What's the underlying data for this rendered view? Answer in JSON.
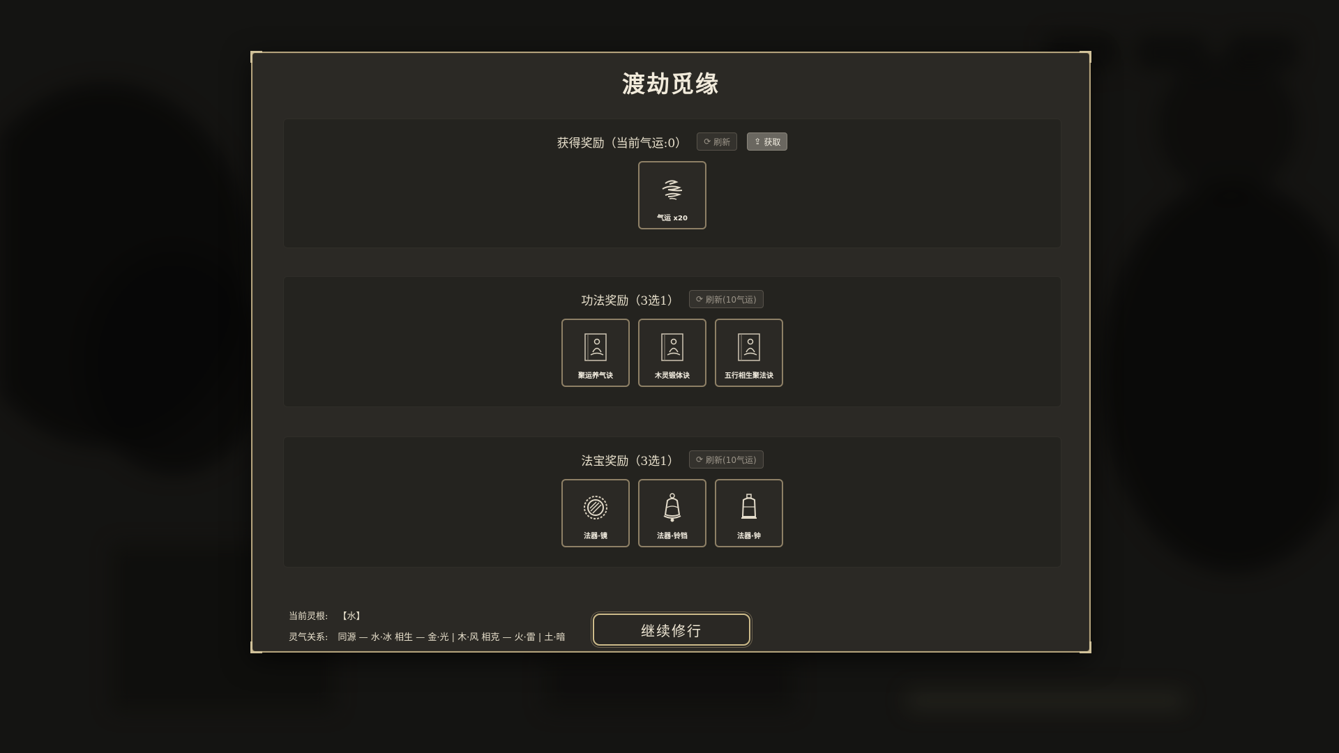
{
  "title": "渡劫觅缘",
  "sections": {
    "gain": {
      "title": "获得奖励（当前气运:0）",
      "refresh_label": "刷新",
      "claim_label": "获取",
      "items": [
        {
          "label": "气运 x20",
          "icon": "cloud-icon"
        }
      ]
    },
    "technique": {
      "title": "功法奖励（3选1）",
      "refresh_label": "刷新(10气运)",
      "items": [
        {
          "label": "聚运养气诀",
          "icon": "meditation-scroll-icon"
        },
        {
          "label": "木灵锻体诀",
          "icon": "meditation-scroll-icon"
        },
        {
          "label": "五行相生聚法诀",
          "icon": "meditation-scroll-icon"
        }
      ]
    },
    "treasure": {
      "title": "法宝奖励（3选1）",
      "refresh_label": "刷新(10气运)",
      "items": [
        {
          "label": "法器·镜",
          "icon": "mirror-icon"
        },
        {
          "label": "法器·铃铛",
          "icon": "bell-icon"
        },
        {
          "label": "法器·钟",
          "icon": "chime-icon"
        }
      ]
    }
  },
  "footer": {
    "root_label": "当前灵根:",
    "root_value": "【水】",
    "relation_label": "灵气关系:",
    "relation_value": "同源 — 水·冰  相生 — 金·光 | 木·风  相克 — 火·雷 | 土·暗"
  },
  "continue_label": "继续修行",
  "colors": {
    "border_gold": "#b3a27c",
    "panel_bg": "#2b2925",
    "section_bg": "#24231f"
  }
}
